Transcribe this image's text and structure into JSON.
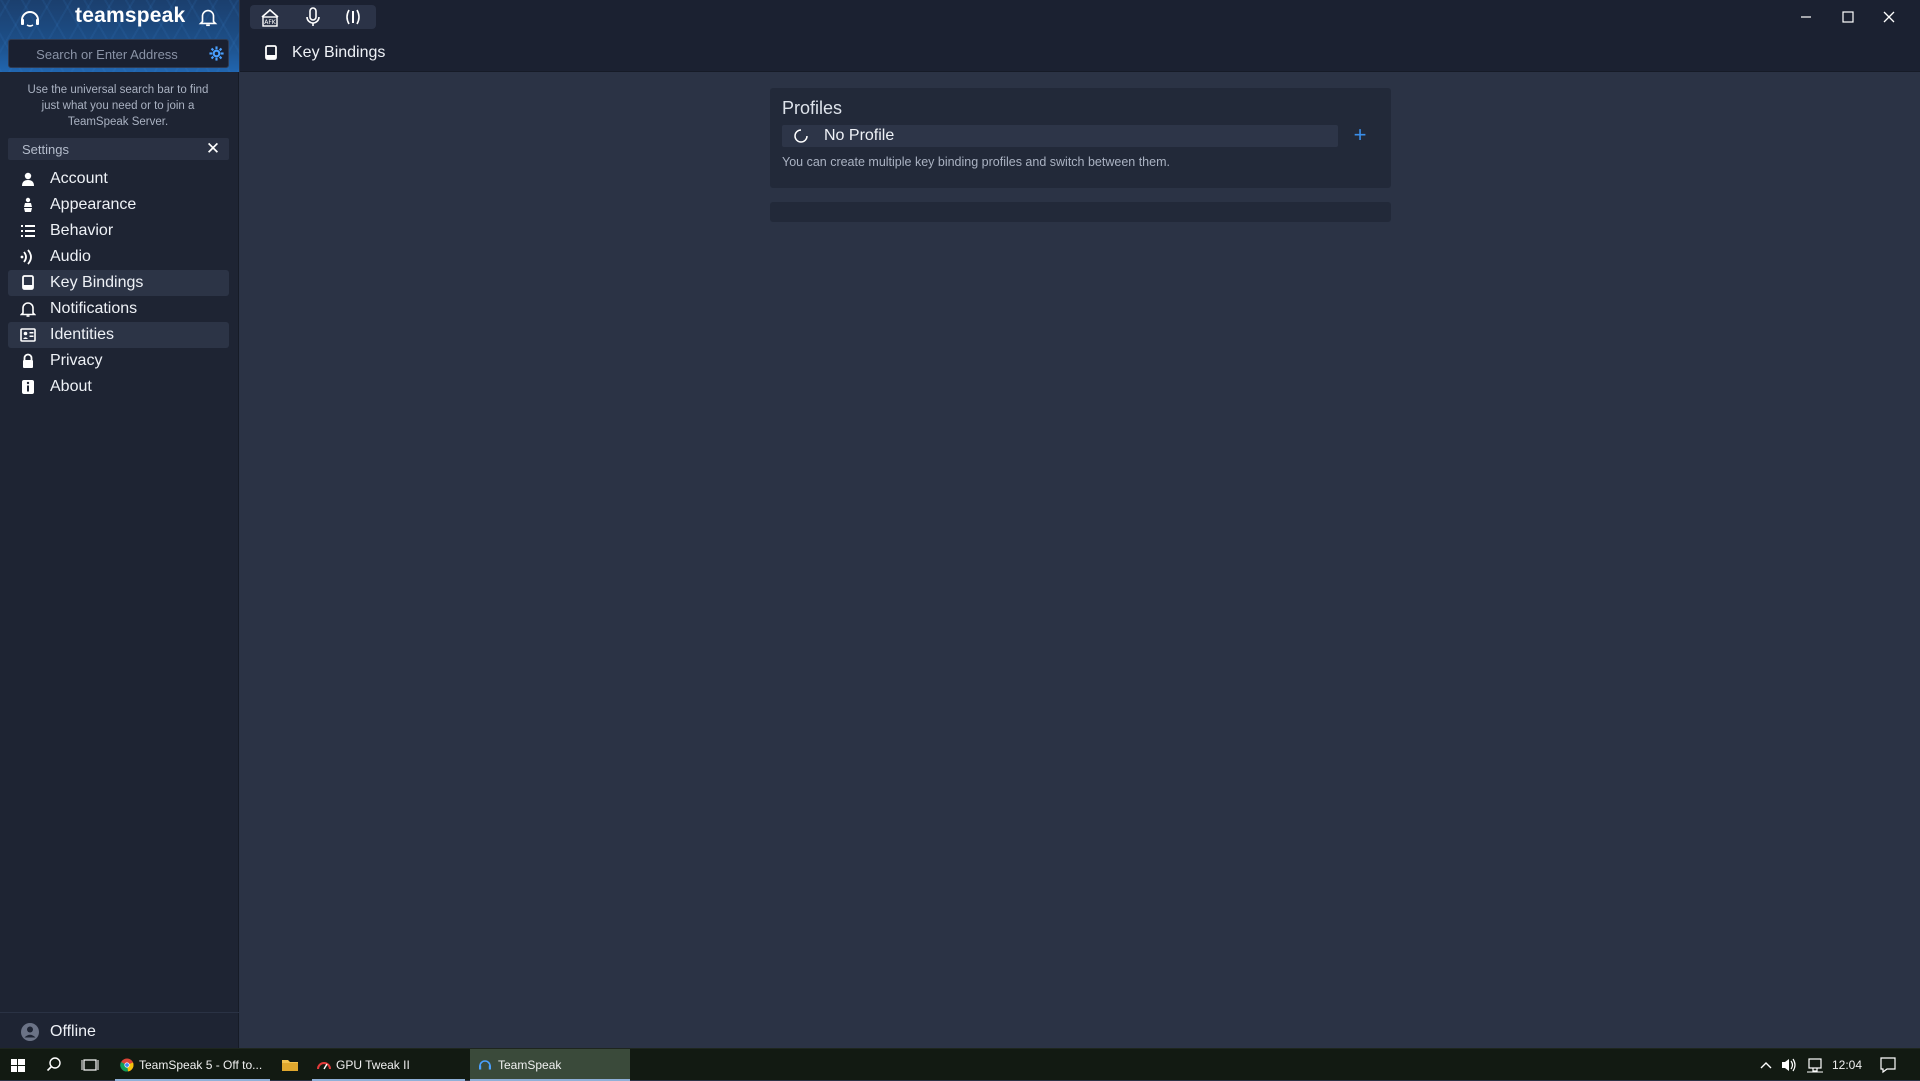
{
  "app": {
    "brand": "teamspeak",
    "search": {
      "placeholder": "Search or Enter Address",
      "value": ""
    },
    "hint": "Use the universal search bar to find just what you need or to join a TeamSpeak Server.",
    "settings_header": "Settings",
    "nav": [
      {
        "label": "Account",
        "icon": "user-icon"
      },
      {
        "label": "Appearance",
        "icon": "appearance-icon"
      },
      {
        "label": "Behavior",
        "icon": "list-icon"
      },
      {
        "label": "Audio",
        "icon": "audio-icon"
      },
      {
        "label": "Key Bindings",
        "icon": "key-bindings-icon",
        "active": true
      },
      {
        "label": "Notifications",
        "icon": "bell-icon"
      },
      {
        "label": "Identities",
        "icon": "identity-card-icon"
      },
      {
        "label": "Privacy",
        "icon": "lock-icon"
      },
      {
        "label": "About",
        "icon": "info-icon"
      }
    ],
    "status": "Offline",
    "accent": "#3a8eea"
  },
  "page": {
    "title": "Key Bindings",
    "profiles": {
      "title": "Profiles",
      "selected": "No Profile",
      "description": "You can create multiple key binding profiles and switch between them.",
      "add_label": "+"
    }
  },
  "taskbar": {
    "apps": [
      {
        "label": "TeamSpeak 5 - Off to...",
        "icon": "chrome-icon"
      },
      {
        "label": "GPU Tweak II",
        "icon": "gpu-tweak-icon"
      },
      {
        "label": "TeamSpeak",
        "icon": "teamspeak-icon",
        "active": true
      }
    ],
    "time": "12:04"
  }
}
